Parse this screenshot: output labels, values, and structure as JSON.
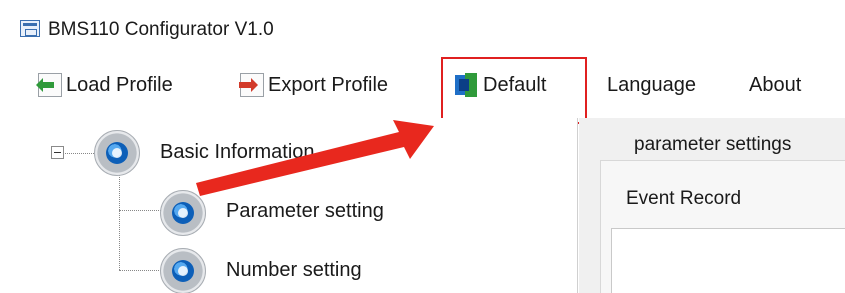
{
  "window": {
    "title": "BMS110 Configurator V1.0",
    "icon": "app-window-icon"
  },
  "menu": {
    "load_profile": "Load Profile",
    "export_profile": "Export Profile",
    "default": "Default",
    "language": "Language",
    "about": "About"
  },
  "tree": {
    "items": [
      {
        "label": "Basic Information",
        "icon": "gear-icon"
      },
      {
        "label": "Parameter setting",
        "icon": "gear-icon"
      },
      {
        "label": "Number setting",
        "icon": "gear-icon"
      }
    ]
  },
  "panel": {
    "tab_label": "parameter settings",
    "heading": "Event Record"
  },
  "annotation": {
    "highlight_color": "#e02020"
  }
}
